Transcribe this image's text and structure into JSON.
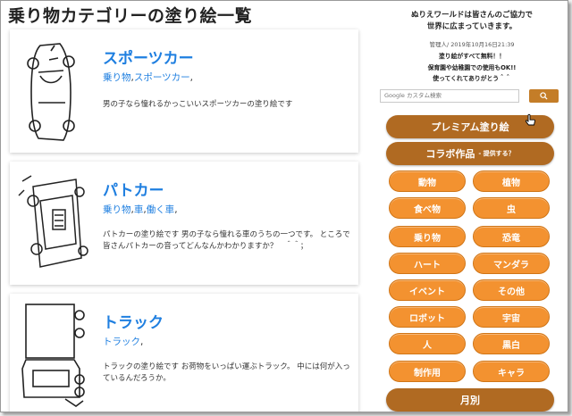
{
  "page_title": "乗り物カテゴリーの塗り絵一覧",
  "cards": [
    {
      "title": "スポーツカー",
      "tags": [
        "乗り物",
        "スポーツカー"
      ],
      "description": "男の子なら憧れるかっこいいスポーツカーの塗り絵です",
      "thumb_icon": "sports-car-coloring-icon"
    },
    {
      "title": "パトカー",
      "tags": [
        "乗り物",
        "車",
        "働く車"
      ],
      "description": "パトカーの塗り絵です 男の子なら憧れる車のうちの一つです。 ところで皆さんパトカーの音ってどんなんかわかりますか？　＾＾；",
      "thumb_icon": "police-car-coloring-icon"
    },
    {
      "title": "トラック",
      "tags": [
        "トラック"
      ],
      "description": "トラックの塗り絵です お荷物をいっぱい運ぶトラック。 中には何が入っているんだろうか。",
      "thumb_icon": "truck-coloring-icon"
    }
  ],
  "sidebar": {
    "intro_line1": "ぬりえワールドは皆さんのご協力で",
    "intro_line2": "世界に広まっていきます。",
    "meta": "管理人/ 2019年10月16日21:39",
    "promo_line1": "塗り絵がすべて無料！！",
    "promo_line2": "保育園や幼稚園での使用もOK!!",
    "promo_line3": "使ってくれてありがとう＾＾",
    "search_placeholder": "Google カスタム検索",
    "premium_label": "プレミアム塗り絵",
    "collab_label": "コラボ作品",
    "collab_sub": "- 提供する？",
    "categories": [
      "動物",
      "植物",
      "食べ物",
      "虫",
      "乗り物",
      "恐竜",
      "ハート",
      "マンダラ",
      "イベント",
      "その他",
      "ロボット",
      "宇宙",
      "人",
      "黒白",
      "制作用",
      "キャラ"
    ],
    "monthly_label": "月別"
  },
  "colors": {
    "link_blue": "#1f7fe0",
    "category_orange": "#f39230",
    "dark_orange": "#b06a22"
  }
}
